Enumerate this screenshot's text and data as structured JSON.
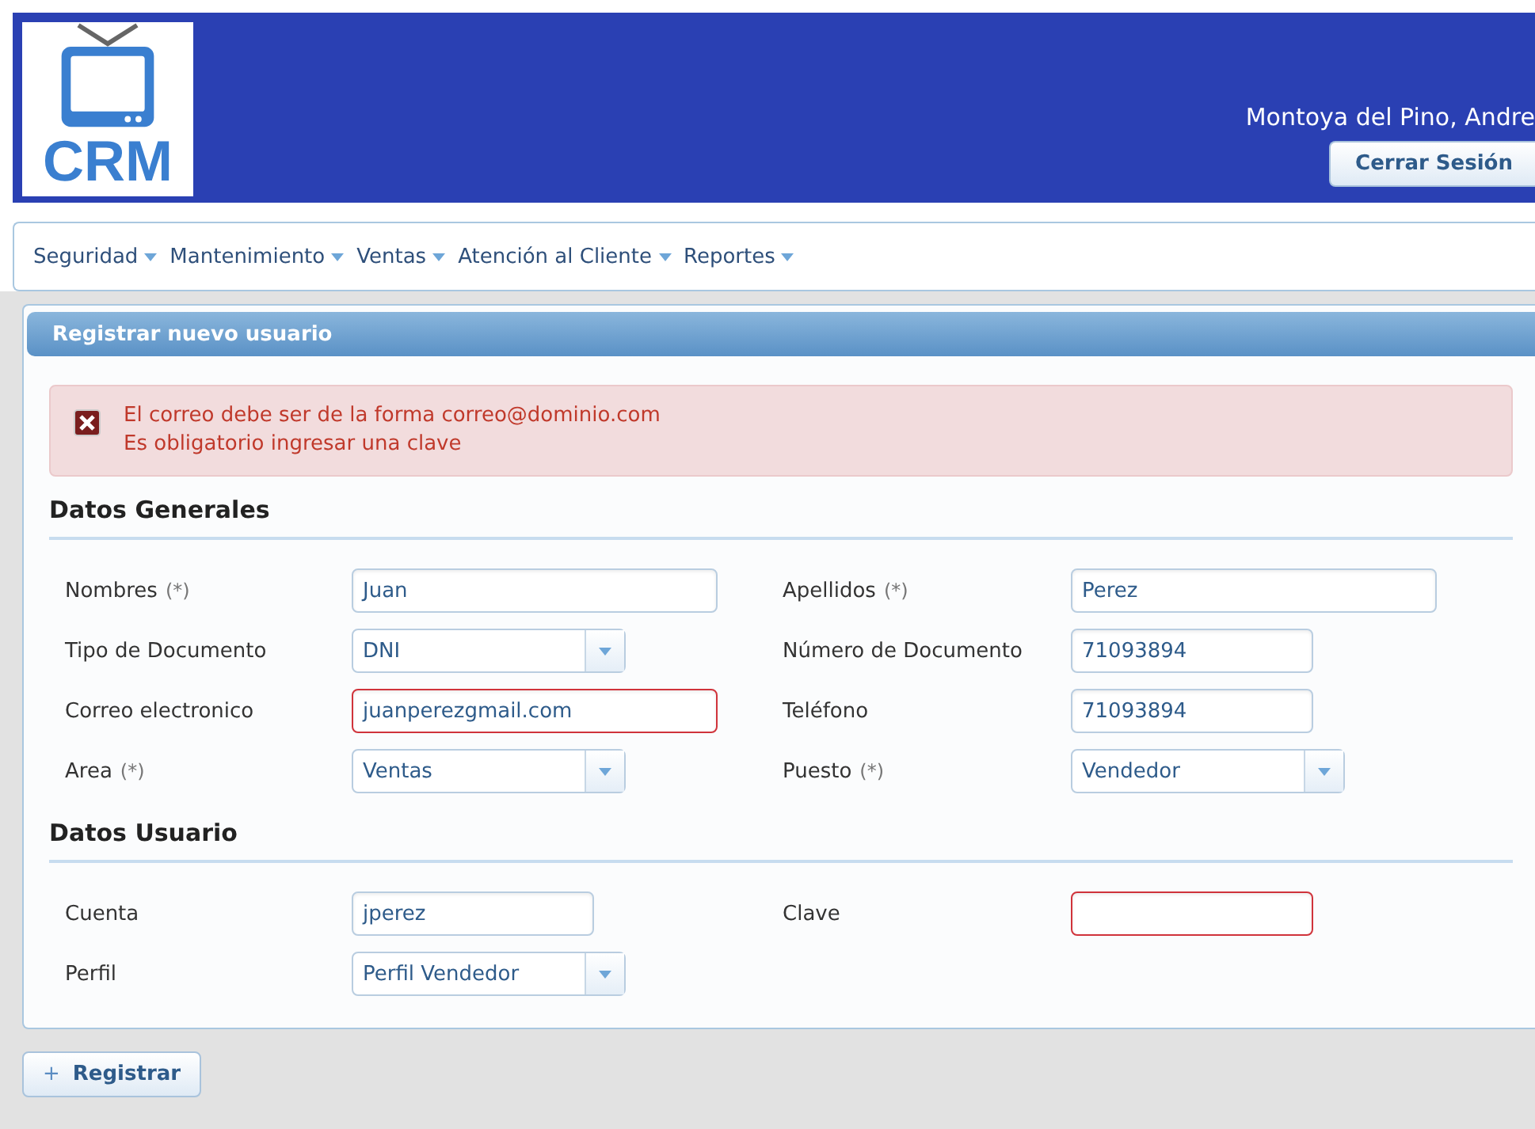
{
  "header": {
    "logo_text": "CRM",
    "user_name": "Montoya del Pino, Andre",
    "logout_button": "Cerrar Sesión"
  },
  "menu": [
    {
      "label": "Seguridad"
    },
    {
      "label": "Mantenimiento"
    },
    {
      "label": "Ventas"
    },
    {
      "label": "Atención al Cliente"
    },
    {
      "label": "Reportes"
    }
  ],
  "panel": {
    "title": "Registrar nuevo usuario",
    "errors": [
      "El correo debe ser de la forma correo@dominio.com",
      "Es obligatorio ingresar una clave"
    ],
    "sections": [
      {
        "title": "Datos Generales",
        "fields": [
          {
            "label": "Nombres",
            "required_mark": "(*)",
            "kind": "longtext",
            "value": "Juan",
            "error": false
          },
          {
            "label": "Apellidos",
            "required_mark": "(*)",
            "kind": "longtext",
            "value": "Perez",
            "error": false
          },
          {
            "label": "Tipo de Documento",
            "kind": "select",
            "value": "DNI",
            "error": false
          },
          {
            "label": "Número de Documento",
            "kind": "shorttext",
            "value": "71093894",
            "error": false
          },
          {
            "label": "Correo electronico",
            "kind": "longtext",
            "value": "juanperezgmail.com",
            "error": true
          },
          {
            "label": "Teléfono",
            "kind": "shorttext",
            "value": "71093894",
            "error": false
          },
          {
            "label": "Area",
            "required_mark": "(*)",
            "kind": "select",
            "value": "Ventas",
            "error": false
          },
          {
            "label": "Puesto",
            "required_mark": "(*)",
            "kind": "select",
            "value": "Vendedor",
            "error": false
          }
        ]
      },
      {
        "title": "Datos Usuario",
        "fields": [
          {
            "label": "Cuenta",
            "kind": "shorttext",
            "value": "jperez",
            "error": false
          },
          {
            "label": "Clave",
            "kind": "password",
            "error": true
          },
          {
            "label": "Perfil",
            "kind": "select",
            "value": "Perfil Vendedor",
            "error": false
          }
        ]
      }
    ]
  },
  "submit_button": {
    "icon": "+",
    "label": "Registrar"
  }
}
